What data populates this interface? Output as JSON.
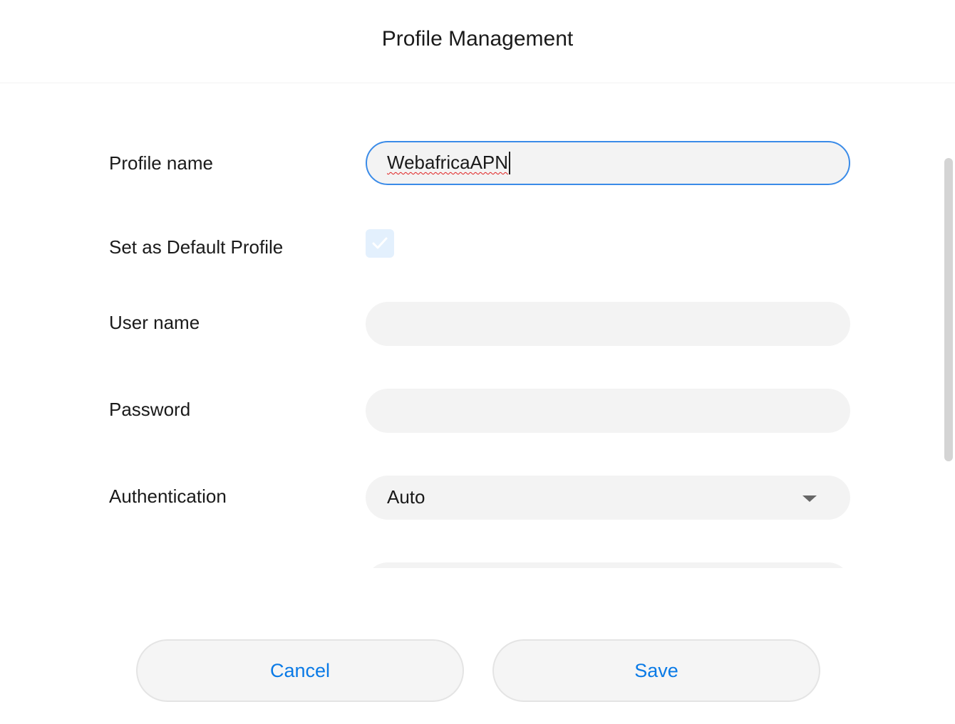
{
  "header": {
    "title": "Profile Management"
  },
  "form": {
    "profile_name": {
      "label": "Profile name",
      "value": "WebafricaAPN"
    },
    "default_profile": {
      "label": "Set as Default Profile",
      "checked": true
    },
    "user_name": {
      "label": "User name",
      "value": ""
    },
    "password": {
      "label": "Password",
      "value": ""
    },
    "authentication": {
      "label": "Authentication",
      "selected": "Auto"
    }
  },
  "footer": {
    "cancel_label": "Cancel",
    "save_label": "Save"
  },
  "colors": {
    "accent": "#0a7ae6",
    "focus_border": "#3a8be8",
    "field_bg": "#f3f3f3",
    "checkbox_bg": "#e3f0fd"
  },
  "icons": {
    "checkbox": "check-icon",
    "dropdown": "chevron-down-icon"
  }
}
